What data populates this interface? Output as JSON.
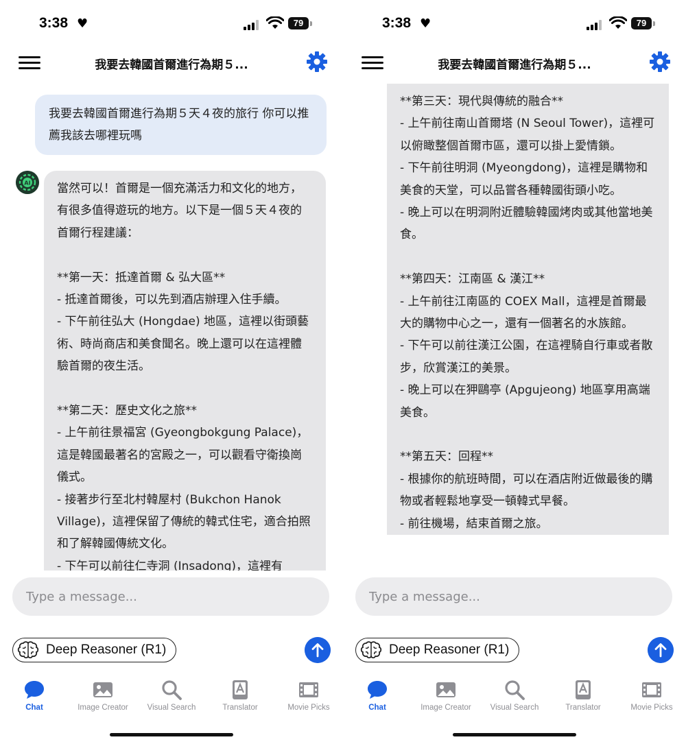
{
  "status": {
    "time": "3:38",
    "battery": "79"
  },
  "header": {
    "title": "我要去韓國首爾進行為期５..."
  },
  "user_message": "我要去韓國首爾進行為期５天４夜的旅行 你可以推薦我該去哪裡玩嗎",
  "bot_avatar_label": "AI",
  "bot_lines_left": [
    "當然可以！首爾是一個充滿活力和文化的地方，有很多值得遊玩的地方。以下是一個５天４夜的首爾行程建議：",
    "",
    "**第一天：抵達首爾 & 弘大區**",
    "- 抵達首爾後，可以先到酒店辦理入住手續。",
    "- 下午前往弘大 (Hongdae) 地區，這裡以街頭藝術、時尚商店和美食聞名。晚上還可以在這裡體驗首爾的夜生活。",
    "",
    "**第二天：歷史文化之旅**",
    "- 上午前往景福宮 (Gyeongbokgung Palace)，這是韓國最著名的宮殿之一，可以觀看守衛換崗儀式。",
    "- 接著步行至北村韓屋村 (Bukchon Hanok Village)，這裡保留了傳統的韓式住宅，適合拍照和了解韓國傳統文化。",
    "- 下午可以前往仁寺洞 (Insadong)，這裡有"
  ],
  "bot_lines_right": [
    "**第三天：現代與傳統的融合**",
    "- 上午前往南山首爾塔 (N Seoul Tower)，這裡可以俯瞰整個首爾市區，還可以掛上愛情鎖。",
    "- 下午前往明洞 (Myeongdong)，這裡是購物和美食的天堂，可以品嘗各種韓國街頭小吃。",
    "- 晚上可以在明洞附近體驗韓國烤肉或其他當地美食。",
    "",
    "**第四天：江南區 & 漢江**",
    "- 上午前往江南區的 COEX Mall，這裡是首爾最大的購物中心之一，還有一個著名的水族館。",
    "- 下午可以前往漢江公園，在這裡騎自行車或者散步，欣賞漢江的美景。",
    "- 晚上可以在狎鷗亭 (Apgujeong) 地區享用高端美食。",
    "",
    "**第五天：回程**",
    "- 根據你的航班時間，可以在酒店附近做最後的購物或者輕鬆地享受一頓韓式早餐。",
    "- 前往機場，結束首爾之旅。"
  ],
  "input": {
    "placeholder": "Type a message..."
  },
  "model": {
    "label": "Deep Reasoner (R1)"
  },
  "tabs": [
    {
      "label": "Chat",
      "icon": "chat-bubble-icon",
      "active": true
    },
    {
      "label": "Image Creator",
      "icon": "image-icon",
      "active": false
    },
    {
      "label": "Visual Search",
      "icon": "magnifier-icon",
      "active": false
    },
    {
      "label": "Translator",
      "icon": "translate-icon",
      "active": false
    },
    {
      "label": "Movie Picks",
      "icon": "film-icon",
      "active": false
    }
  ],
  "colors": {
    "accent": "#1a5fe0",
    "user_bubble": "#e3ebf8",
    "bot_bubble": "#e6e6e8"
  }
}
